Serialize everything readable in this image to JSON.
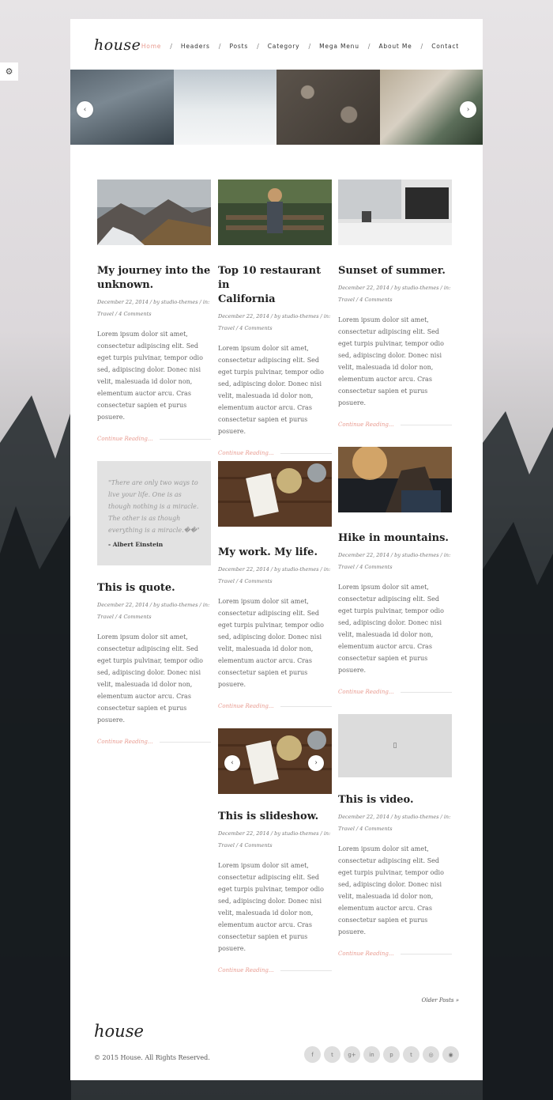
{
  "site": {
    "logo": "house",
    "footer_logo": "house",
    "copyright": "© 2015 House. All Rights Reserved."
  },
  "nav": {
    "items": [
      "Home",
      "Headers",
      "Posts",
      "Category",
      "Mega Menu",
      "About Me",
      "Contact"
    ],
    "active": "Home",
    "separator": "/"
  },
  "slider": {
    "prev_label": "‹",
    "next_label": "›"
  },
  "posts": [
    {
      "title_lines": [
        "My journey into the",
        "unknown."
      ],
      "meta_lines": [
        "December 22, 2014 / by studio-themes / in:",
        "Travel / 4 Comments"
      ],
      "excerpt_lines": [
        "Lorem ipsum dolor sit amet,",
        "consectetur adipiscing elit. Sed",
        "eget turpis pulvinar, tempor odio",
        "sed, adipiscing dolor. Donec nisi",
        "velit, malesuada id dolor non,",
        "elementum auctor arcu. Cras",
        "consectetur sapien et purus",
        "posuere."
      ],
      "more": "Continue Reading..."
    },
    {
      "title_lines": [
        "Top 10 restaurant in",
        "California"
      ],
      "meta_lines": [
        "December 22, 2014 / by studio-themes / in:",
        "Travel / 4 Comments"
      ],
      "excerpt_lines": [
        "Lorem ipsum dolor sit amet,",
        "consectetur adipiscing elit. Sed",
        "eget turpis pulvinar, tempor odio",
        "sed, adipiscing dolor. Donec nisi",
        "velit, malesuada id dolor non,",
        "elementum auctor arcu. Cras",
        "consectetur sapien et purus",
        "posuere."
      ],
      "more": "Continue Reading..."
    },
    {
      "title_lines": [
        "Sunset of summer."
      ],
      "meta_lines": [
        "December 22, 2014 / by studio-themes / in:",
        "Travel / 4 Comments"
      ],
      "excerpt_lines": [
        "Lorem ipsum dolor sit amet,",
        "consectetur adipiscing elit. Sed",
        "eget turpis pulvinar, tempor odio",
        "sed, adipiscing dolor. Donec nisi",
        "velit, malesuada id dolor non,",
        "elementum auctor arcu. Cras",
        "consectetur sapien et purus",
        "posuere."
      ],
      "more": "Continue Reading..."
    },
    {
      "title_lines": [
        "This is quote."
      ],
      "meta_lines": [
        "December 22, 2014 / by studio-themes / in:",
        "Travel / 4 Comments"
      ],
      "excerpt_lines": [
        "Lorem ipsum dolor sit amet,",
        "consectetur adipiscing elit. Sed",
        "eget turpis pulvinar, tempor odio",
        "sed, adipiscing dolor. Donec nisi",
        "velit, malesuada id dolor non,",
        "elementum auctor arcu. Cras",
        "consectetur sapien et purus",
        "posuere."
      ],
      "more": "Continue Reading...",
      "quote_lines": [
        "\"There are only two ways to",
        "live your life. One is as",
        "though nothing is a miracle.",
        "The other is as though",
        "everything is a miracle.��\""
      ],
      "quote_author": "- Albert Einstein"
    },
    {
      "title_lines": [
        "My work. My life."
      ],
      "meta_lines": [
        "December 22, 2014 / by studio-themes / in:",
        "Travel / 4 Comments"
      ],
      "excerpt_lines": [
        "Lorem ipsum dolor sit amet,",
        "consectetur adipiscing elit. Sed",
        "eget turpis pulvinar, tempor odio",
        "sed, adipiscing dolor. Donec nisi",
        "velit, malesuada id dolor non,",
        "elementum auctor arcu. Cras",
        "consectetur sapien et purus",
        "posuere."
      ],
      "more": "Continue Reading..."
    },
    {
      "title_lines": [
        "Hike in mountains."
      ],
      "meta_lines": [
        "December 22, 2014 / by studio-themes / in:",
        "Travel / 4 Comments"
      ],
      "excerpt_lines": [
        "Lorem ipsum dolor sit amet,",
        "consectetur adipiscing elit. Sed",
        "eget turpis pulvinar, tempor odio",
        "sed, adipiscing dolor. Donec nisi",
        "velit, malesuada id dolor non,",
        "elementum auctor arcu. Cras",
        "consectetur sapien et purus",
        "posuere."
      ],
      "more": "Continue Reading..."
    },
    {
      "title_lines": [
        "This is slideshow."
      ],
      "meta_lines": [
        "December 22, 2014 / by studio-themes / in:",
        "Travel / 4 Comments"
      ],
      "excerpt_lines": [
        "Lorem ipsum dolor sit amet,",
        "consectetur adipiscing elit. Sed",
        "eget turpis pulvinar, tempor odio",
        "sed, adipiscing dolor. Donec nisi",
        "velit, malesuada id dolor non,",
        "elementum auctor arcu. Cras",
        "consectetur sapien et purus",
        "posuere."
      ],
      "more": "Continue Reading..."
    },
    {
      "title_lines": [
        "This is video."
      ],
      "meta_lines": [
        "December 22, 2014 / by studio-themes / in:",
        "Travel / 4 Comments"
      ],
      "excerpt_lines": [
        "Lorem ipsum dolor sit amet,",
        "consectetur adipiscing elit. Sed",
        "eget turpis pulvinar, tempor odio",
        "sed, adipiscing dolor. Donec nisi",
        "velit, malesuada id dolor non,",
        "elementum auctor arcu. Cras",
        "consectetur sapien et purus",
        "posuere."
      ],
      "more": "Continue Reading..."
    }
  ],
  "pagination": {
    "older": "Older Posts »"
  },
  "social": [
    {
      "icon": "facebook-icon",
      "glyph": "f"
    },
    {
      "icon": "twitter-icon",
      "glyph": "t"
    },
    {
      "icon": "google-plus-icon",
      "glyph": "g+"
    },
    {
      "icon": "linkedin-icon",
      "glyph": "in"
    },
    {
      "icon": "pinterest-icon",
      "glyph": "p"
    },
    {
      "icon": "tumblr-icon",
      "glyph": "t"
    },
    {
      "icon": "instagram-icon",
      "glyph": "◎"
    },
    {
      "icon": "rss-icon",
      "glyph": "◉"
    }
  ],
  "colors": {
    "accent": "#e89a8f",
    "text": "#222222",
    "muted": "#777777"
  }
}
